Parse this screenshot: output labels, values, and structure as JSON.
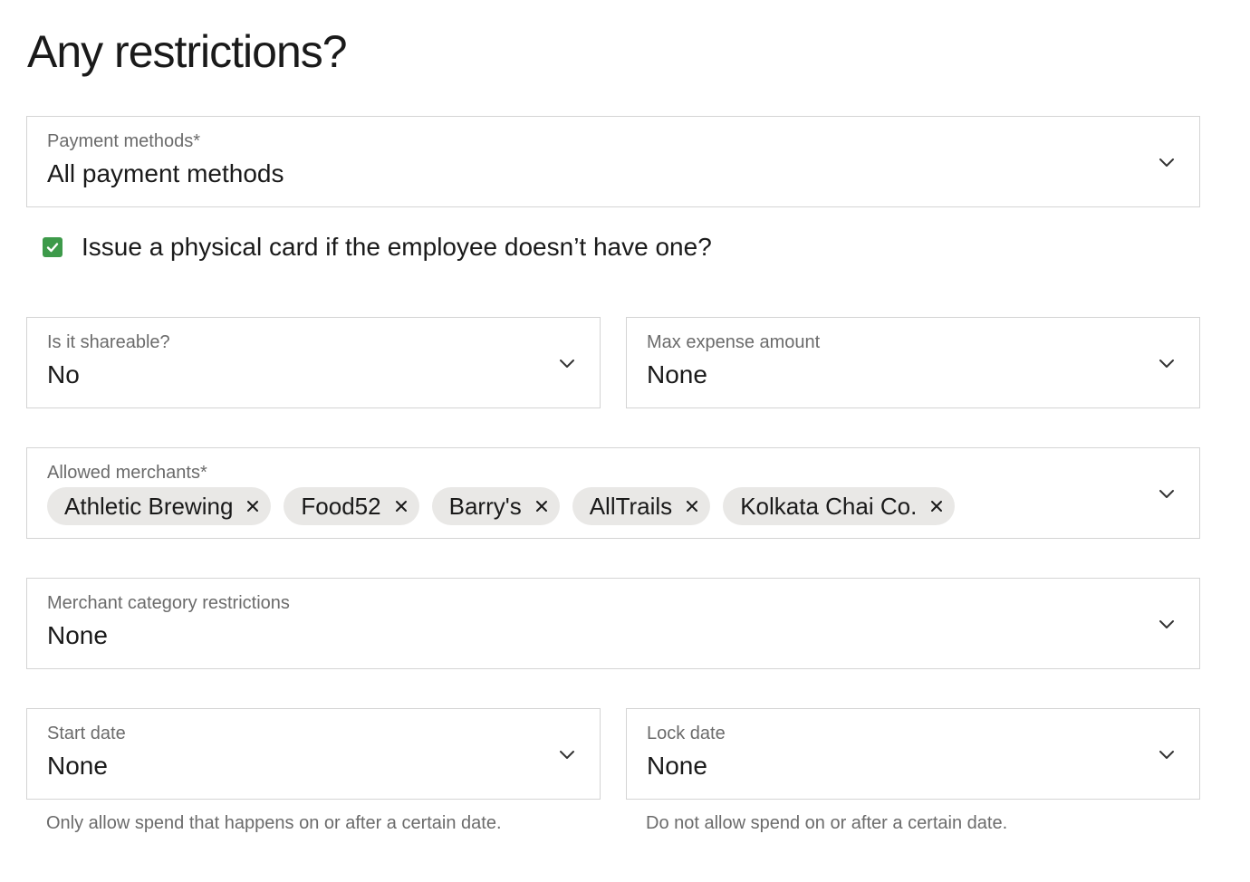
{
  "page": {
    "title": "Any restrictions?"
  },
  "payment_methods": {
    "label": "Payment methods*",
    "value": "All payment methods"
  },
  "physical_card": {
    "checked": true,
    "label": "Issue a physical card if the employee doesn’t have one?"
  },
  "shareable": {
    "label": "Is it shareable?",
    "value": "No"
  },
  "max_expense": {
    "label": "Max expense amount",
    "value": "None"
  },
  "allowed_merchants": {
    "label": "Allowed merchants*",
    "chips": [
      "Athletic Brewing",
      "Food52",
      "Barry's",
      "AllTrails",
      "Kolkata Chai Co."
    ]
  },
  "merchant_category": {
    "label": "Merchant category restrictions",
    "value": "None"
  },
  "start_date": {
    "label": "Start date",
    "value": "None",
    "helper": "Only allow spend that happens on or after a certain date."
  },
  "lock_date": {
    "label": "Lock date",
    "value": "None",
    "helper": "Do not allow spend on or after a certain date."
  },
  "icons": {
    "dropdown": "chevron-down-icon",
    "remove": "close-icon",
    "check": "checkmark-icon"
  },
  "colors": {
    "checkbox": "#3d9a4a",
    "chip_bg": "#e9e8e6",
    "border": "#d4d4d4"
  }
}
